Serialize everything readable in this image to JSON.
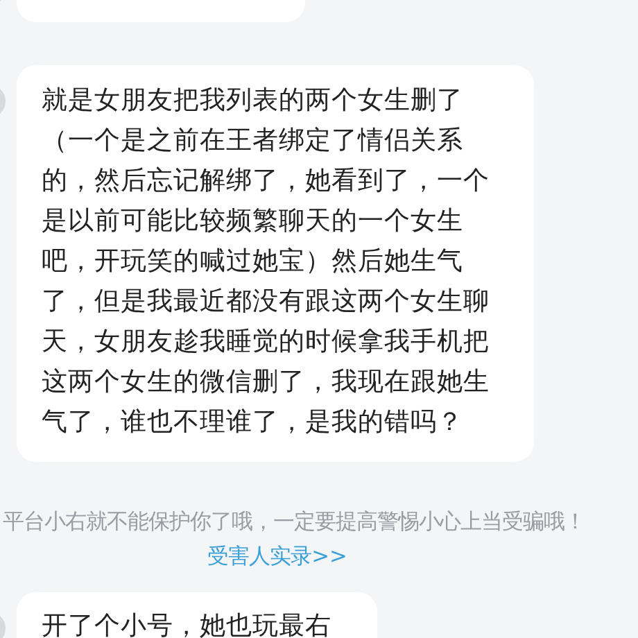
{
  "messages": [
    {
      "text": "就是女朋友把我列表的两个女生删了（一个是之前在王者绑定了情侣关系的，然后忘记解绑了，她看到了，一个是以前可能比较频繁聊天的一个女生吧，开玩笑的喊过她宝）然后她生气了，但是我最近都没有跟这两个女生聊天，女朋友趁我睡觉的时候拿我手机把这两个女生的微信删了，我现在跟她生气了，谁也不理谁了，是我的错吗？"
    }
  ],
  "notice": {
    "text": "平台小右就不能保护你了哦，一定要提高警惕小心上当受骗哦！",
    "link": "受害人实录>>"
  },
  "last_message": {
    "text": "开了个小号，她也玩最右"
  }
}
